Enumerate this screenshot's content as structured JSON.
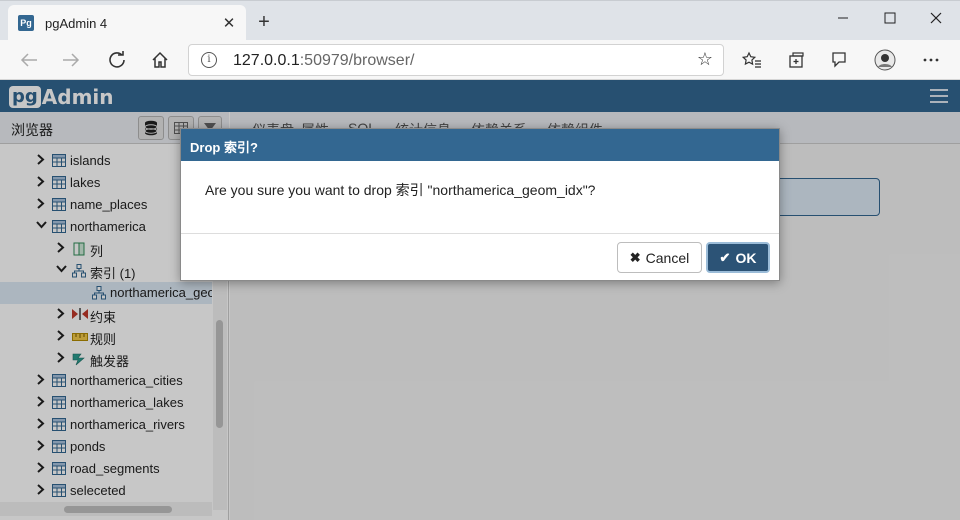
{
  "browser": {
    "tab_title": "pgAdmin 4",
    "favicon_text": "Pg",
    "url_host": "127.0.0.1",
    "url_rest": ":50979/browser/"
  },
  "app": {
    "logo_pg": "pg",
    "logo_admin": "Admin",
    "accent_color": "#336791"
  },
  "browser_panel": {
    "title": "浏览器",
    "tree": [
      {
        "label": "islands",
        "type": "table",
        "expanded": false,
        "level": 2
      },
      {
        "label": "lakes",
        "type": "table",
        "expanded": false,
        "level": 2
      },
      {
        "label": "name_places",
        "type": "table",
        "expanded": false,
        "level": 2
      },
      {
        "label": "northamerica",
        "type": "table",
        "expanded": true,
        "level": 2
      },
      {
        "label": "列",
        "type": "columns",
        "expanded": false,
        "level": 3
      },
      {
        "label": "索引 (1)",
        "type": "indexes",
        "expanded": true,
        "level": 3
      },
      {
        "label": "northamerica_geom_idx",
        "type": "index",
        "selected": true,
        "level": 4
      },
      {
        "label": "约束",
        "type": "constraints",
        "expanded": false,
        "level": 3
      },
      {
        "label": "规则",
        "type": "rules",
        "expanded": false,
        "level": 3
      },
      {
        "label": "触发器",
        "type": "triggers",
        "expanded": false,
        "level": 3
      },
      {
        "label": "northamerica_cities",
        "type": "table",
        "expanded": false,
        "level": 2
      },
      {
        "label": "northamerica_lakes",
        "type": "table",
        "expanded": false,
        "level": 2
      },
      {
        "label": "northamerica_rivers",
        "type": "table",
        "expanded": false,
        "level": 2
      },
      {
        "label": "ponds",
        "type": "table",
        "expanded": false,
        "level": 2
      },
      {
        "label": "road_segments",
        "type": "table",
        "expanded": false,
        "level": 2
      },
      {
        "label": "seleceted",
        "type": "table",
        "expanded": false,
        "level": 2
      }
    ]
  },
  "main_tabs": [
    "仪表盘",
    "属性",
    "SQL",
    "统计信息",
    "依赖关系",
    "依赖组件"
  ],
  "dialog": {
    "title": "Drop 索引?",
    "message": "Are you sure you want to drop 索引 \"northamerica_geom_idx\"?",
    "cancel_label": "Cancel",
    "ok_label": "OK"
  }
}
